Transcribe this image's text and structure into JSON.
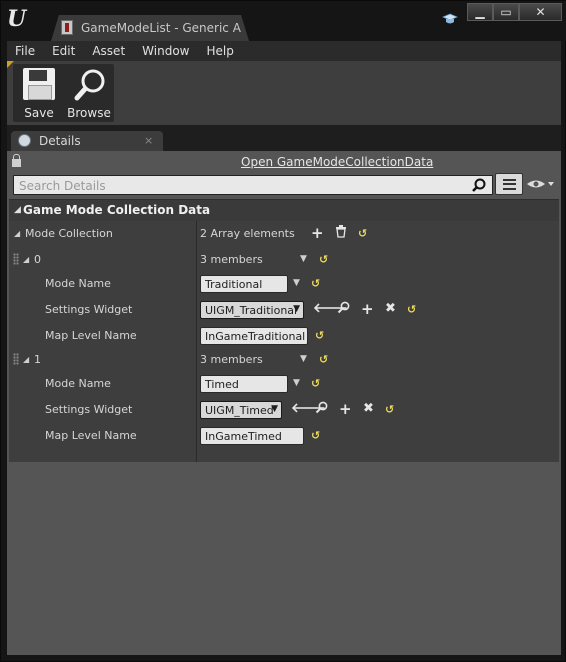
{
  "window": {
    "tab_title": "GameModeList - Generic A",
    "min_glyph": "▁",
    "max_glyph": "▭",
    "close_glyph": "✕"
  },
  "menu": [
    "File",
    "Edit",
    "Asset",
    "Window",
    "Help"
  ],
  "toolbar": {
    "save_label": "Save",
    "browse_label": "Browse"
  },
  "details": {
    "tab_label": "Details",
    "tab_close": "×",
    "open_link": "Open GameModeCollectionData",
    "search_placeholder": "Search Details",
    "category_label": "Game Mode Collection Data",
    "property": {
      "name": "Mode Collection",
      "value": "2 Array elements"
    },
    "elements": [
      {
        "index": "0",
        "summary": "3 members",
        "mode_name_label": "Mode Name",
        "mode_name": "Traditional",
        "settings_widget_label": "Settings Widget",
        "settings_widget": "UIGM_Traditional",
        "map_level_label": "Map Level Name",
        "map_level": "InGameTraditional"
      },
      {
        "index": "1",
        "summary": "3 members",
        "mode_name_label": "Mode Name",
        "mode_name": "Timed",
        "settings_widget_label": "Settings Widget",
        "settings_widget": "UIGM_Timed",
        "map_level_label": "Map Level Name",
        "map_level": "InGameTimed"
      }
    ]
  },
  "colors": {
    "panel_bg": "#555555",
    "grid_bg": "#3e3e3e",
    "reset_arrow": "#e8d860",
    "toolbar_bg": "#3e3e3e"
  }
}
